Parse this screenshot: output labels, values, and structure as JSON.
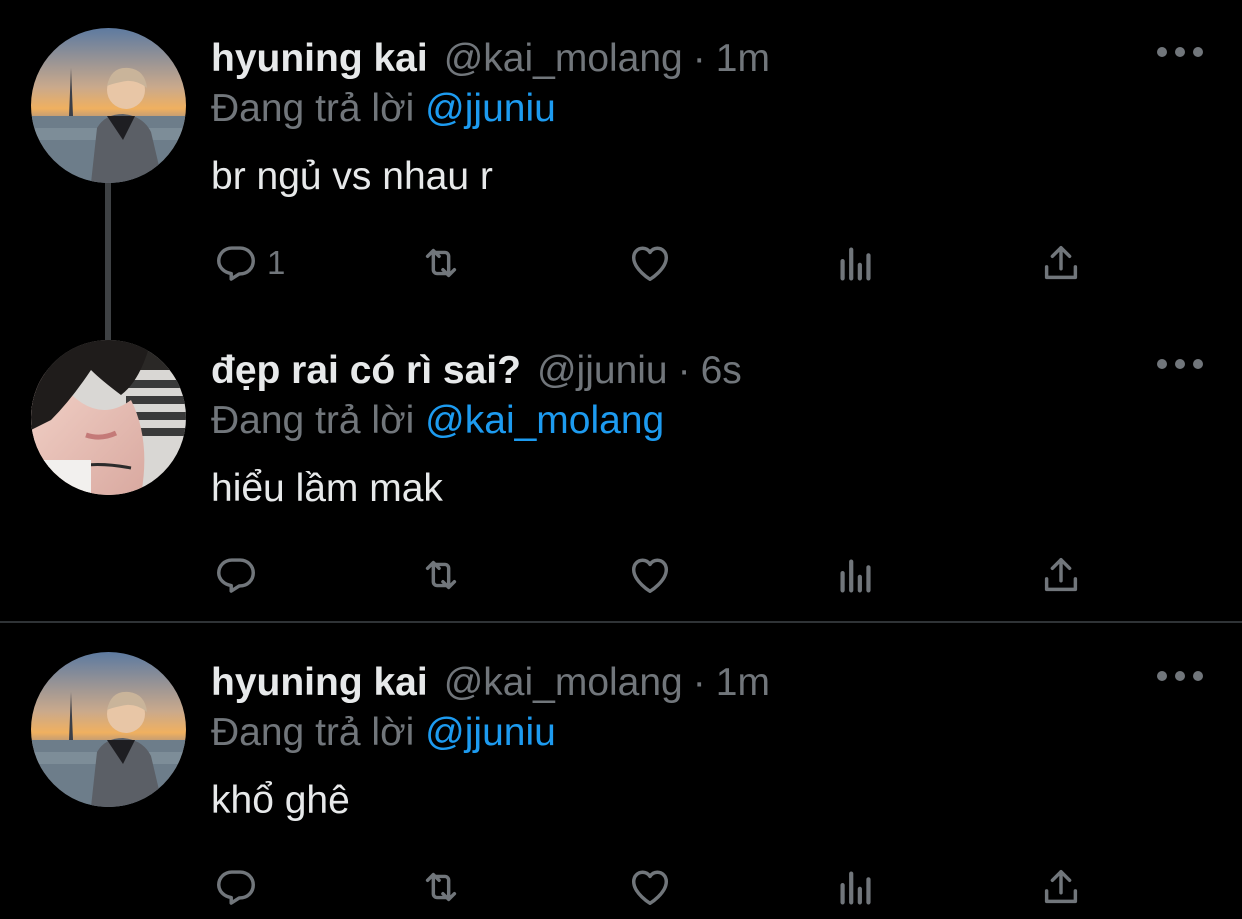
{
  "tweets": [
    {
      "name": "hyuning kai",
      "handle": "@kai_molang",
      "separator": "·",
      "time": "1m",
      "reply_prefix": "Đang trả lời",
      "reply_to": "@jjuniu",
      "content": "br ngủ vs nhau r",
      "reply_count": "1",
      "avatar": "avatar-paris-sunset"
    },
    {
      "name": "đẹp rai có rì sai?",
      "handle": "@jjuniu",
      "separator": "·",
      "time": "6s",
      "reply_prefix": "Đang trả lời",
      "reply_to": "@kai_molang",
      "content": "hiểu lầm mak",
      "reply_count": "",
      "avatar": "avatar-sleeping"
    },
    {
      "name": "hyuning kai",
      "handle": "@kai_molang",
      "separator": "·",
      "time": "1m",
      "reply_prefix": "Đang trả lời",
      "reply_to": "@jjuniu",
      "content": "khổ ghê",
      "reply_count": "",
      "avatar": "avatar-paris-sunset"
    }
  ],
  "icons": {
    "reply": "reply-icon",
    "retweet": "retweet-icon",
    "like": "heart-icon",
    "views": "analytics-icon",
    "share": "share-icon",
    "more": "more-icon"
  },
  "colors": {
    "background": "#000000",
    "text": "#e7e9ea",
    "secondary": "#71767b",
    "link": "#1d9bf0",
    "divider": "#2f3336",
    "thread_line": "#3e4144"
  }
}
